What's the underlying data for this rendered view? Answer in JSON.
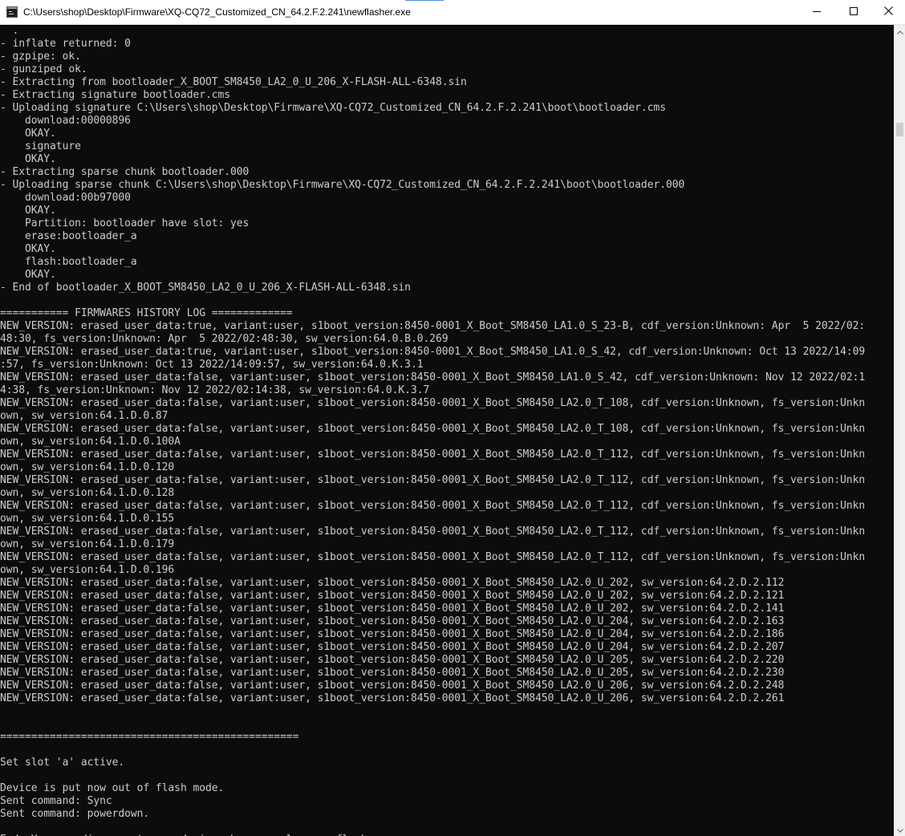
{
  "window": {
    "title": "C:\\Users\\shop\\Desktop\\Firmware\\XQ-CQ72_Customized_CN_64.2.F.2.241\\newflasher.exe",
    "icon": "console-app-icon",
    "controls": {
      "minimize_icon": "minimize-icon",
      "maximize_icon": "maximize-icon",
      "close_icon": "close-icon"
    }
  },
  "console": {
    "background": "#0c0c0c",
    "foreground": "#cccccc",
    "lines": [
      "  .",
      "- inflate returned: 0",
      "- gzpipe: ok.",
      "- gunziped ok.",
      "- Extracting from bootloader_X_BOOT_SM8450_LA2_0_U_206_X-FLASH-ALL-6348.sin",
      "- Extracting signature bootloader.cms",
      "- Uploading signature C:\\Users\\shop\\Desktop\\Firmware\\XQ-CQ72_Customized_CN_64.2.F.2.241\\boot\\bootloader.cms",
      "    download:00000896",
      "    OKAY.",
      "    signature",
      "    OKAY.",
      "- Extracting sparse chunk bootloader.000",
      "- Uploading sparse chunk C:\\Users\\shop\\Desktop\\Firmware\\XQ-CQ72_Customized_CN_64.2.F.2.241\\boot\\bootloader.000",
      "    download:00b97000",
      "    OKAY.",
      "    Partition: bootloader have slot: yes",
      "    erase:bootloader_a",
      "    OKAY.",
      "    flash:bootloader_a",
      "    OKAY.",
      "- End of bootloader_X_BOOT_SM8450_LA2_0_U_206_X-FLASH-ALL-6348.sin",
      "",
      "=========== FIRMWARES HISTORY LOG =============",
      "NEW_VERSION: erased_user_data:true, variant:user, s1boot_version:8450-0001_X_Boot_SM8450_LA1.0_S_23-B, cdf_version:Unknown: Apr  5 2022/02:",
      "48:30, fs_version:Unknown: Apr  5 2022/02:48:30, sw_version:64.0.B.0.269",
      "NEW_VERSION: erased_user_data:true, variant:user, s1boot_version:8450-0001_X_Boot_SM8450_LA1.0_S_42, cdf_version:Unknown: Oct 13 2022/14:09",
      ":57, fs_version:Unknown: Oct 13 2022/14:09:57, sw_version:64.0.K.3.1",
      "NEW_VERSION: erased_user_data:false, variant:user, s1boot_version:8450-0001_X_Boot_SM8450_LA1.0_S_42, cdf_version:Unknown: Nov 12 2022/02:1",
      "4:38, fs_version:Unknown: Nov 12 2022/02:14:38, sw_version:64.0.K.3.7",
      "NEW_VERSION: erased_user_data:false, variant:user, s1boot_version:8450-0001_X_Boot_SM8450_LA2.0_T_108, cdf_version:Unknown, fs_version:Unkn",
      "own, sw_version:64.1.D.0.87",
      "NEW_VERSION: erased_user_data:false, variant:user, s1boot_version:8450-0001_X_Boot_SM8450_LA2.0_T_108, cdf_version:Unknown, fs_version:Unkn",
      "own, sw_version:64.1.D.0.100A",
      "NEW_VERSION: erased_user_data:false, variant:user, s1boot_version:8450-0001_X_Boot_SM8450_LA2.0_T_112, cdf_version:Unknown, fs_version:Unkn",
      "own, sw_version:64.1.D.0.120",
      "NEW_VERSION: erased_user_data:false, variant:user, s1boot_version:8450-0001_X_Boot_SM8450_LA2.0_T_112, cdf_version:Unknown, fs_version:Unkn",
      "own, sw_version:64.1.D.0.128",
      "NEW_VERSION: erased_user_data:false, variant:user, s1boot_version:8450-0001_X_Boot_SM8450_LA2.0_T_112, cdf_version:Unknown, fs_version:Unkn",
      "own, sw_version:64.1.D.0.155",
      "NEW_VERSION: erased_user_data:false, variant:user, s1boot_version:8450-0001_X_Boot_SM8450_LA2.0_T_112, cdf_version:Unknown, fs_version:Unkn",
      "own, sw_version:64.1.D.0.179",
      "NEW_VERSION: erased_user_data:false, variant:user, s1boot_version:8450-0001_X_Boot_SM8450_LA2.0_T_112, cdf_version:Unknown, fs_version:Unkn",
      "own, sw_version:64.1.D.0.196",
      "NEW_VERSION: erased_user_data:false, variant:user, s1boot_version:8450-0001_X_Boot_SM8450_LA2.0_U_202, sw_version:64.2.D.2.112",
      "NEW_VERSION: erased_user_data:false, variant:user, s1boot_version:8450-0001_X_Boot_SM8450_LA2.0_U_202, sw_version:64.2.D.2.121",
      "NEW_VERSION: erased_user_data:false, variant:user, s1boot_version:8450-0001_X_Boot_SM8450_LA2.0_U_202, sw_version:64.2.D.2.141",
      "NEW_VERSION: erased_user_data:false, variant:user, s1boot_version:8450-0001_X_Boot_SM8450_LA2.0_U_204, sw_version:64.2.D.2.163",
      "NEW_VERSION: erased_user_data:false, variant:user, s1boot_version:8450-0001_X_Boot_SM8450_LA2.0_U_204, sw_version:64.2.D.2.186",
      "NEW_VERSION: erased_user_data:false, variant:user, s1boot_version:8450-0001_X_Boot_SM8450_LA2.0_U_204, sw_version:64.2.D.2.207",
      "NEW_VERSION: erased_user_data:false, variant:user, s1boot_version:8450-0001_X_Boot_SM8450_LA2.0_U_205, sw_version:64.2.D.2.220",
      "NEW_VERSION: erased_user_data:false, variant:user, s1boot_version:8450-0001_X_Boot_SM8450_LA2.0_U_205, sw_version:64.2.D.2.230",
      "NEW_VERSION: erased_user_data:false, variant:user, s1boot_version:8450-0001_X_Boot_SM8450_LA2.0_U_206, sw_version:64.2.D.2.248",
      "NEW_VERSION: erased_user_data:false, variant:user, s1boot_version:8450-0001_X_Boot_SM8450_LA2.0_U_206, sw_version:64.2.D.2.261",
      "",
      "",
      "================================================",
      "",
      "Set slot 'a' active.",
      "",
      "Device is put now out of flash mode.",
      "Sent command: Sync",
      "Sent command: powerdown.",
      "",
      "End. You can disconnect your device when you close newflasher.exe"
    ]
  },
  "scrollbar": {
    "up_icon": "scroll-up-arrow-icon",
    "down_icon": "scroll-down-arrow-icon"
  }
}
